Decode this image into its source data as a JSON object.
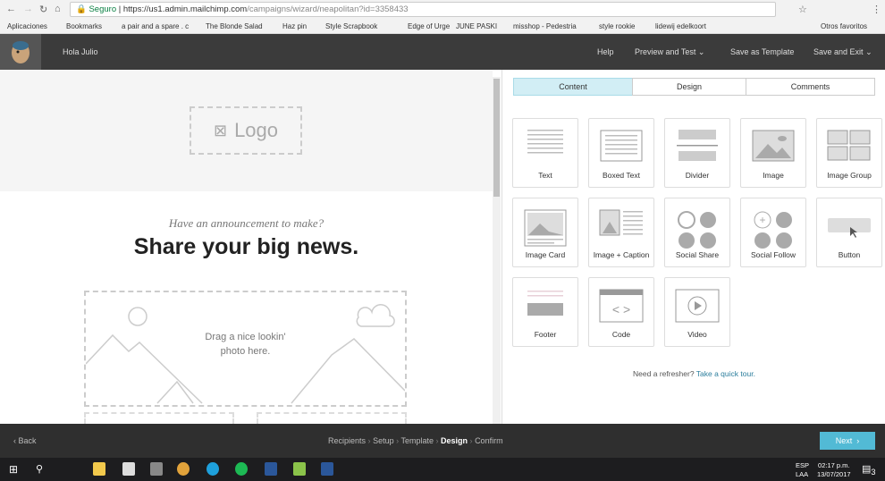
{
  "browser": {
    "secure_label": "Seguro",
    "url_host": "https://us1.admin.mailchimp.com",
    "url_path": "/campaigns/wizard/neapolitan?id=3358433",
    "bookmarks": [
      "Aplicaciones",
      "Bookmarks",
      "a pair and a spare . c",
      "The Blonde Salad",
      "Haz pin",
      "Style Scrapbook",
      "Edge of Urge",
      "JUNE PASKI",
      "misshop - Pedestria",
      "style rookie",
      "lidewij edelkoort"
    ],
    "other_bookmarks": "Otros favoritos"
  },
  "header": {
    "greeting": "Hola Julio",
    "help": "Help",
    "preview": "Preview and Test",
    "save_template": "Save as Template",
    "save_exit": "Save and Exit"
  },
  "editor": {
    "logo_placeholder": "Logo",
    "subtitle": "Have an announcement to make?",
    "headline": "Share your big news.",
    "image_hint_1": "Drag a nice lookin'",
    "image_hint_2": "photo here."
  },
  "panel": {
    "tabs": [
      "Content",
      "Design",
      "Comments"
    ],
    "active_tab": "Content",
    "blocks": [
      "Text",
      "Boxed Text",
      "Divider",
      "Image",
      "Image Group",
      "Image Card",
      "Image + Caption",
      "Social Share",
      "Social Follow",
      "Button",
      "Footer",
      "Code",
      "Video"
    ],
    "refresher": "Need a refresher?",
    "tour_link": "Take a quick tour."
  },
  "footer": {
    "back": "Back",
    "steps": [
      "Recipients",
      "Setup",
      "Template",
      "Design",
      "Confirm"
    ],
    "current_step": "Design",
    "next": "Next"
  },
  "taskbar": {
    "lang1": "ESP",
    "lang2": "LAA",
    "time": "02:17 p.m.",
    "date": "13/07/2017",
    "notifications": "3"
  },
  "colors": {
    "accent": "#52bad5",
    "header_bg": "#3b3b3b",
    "active_tab_bg": "#d2eef5"
  }
}
